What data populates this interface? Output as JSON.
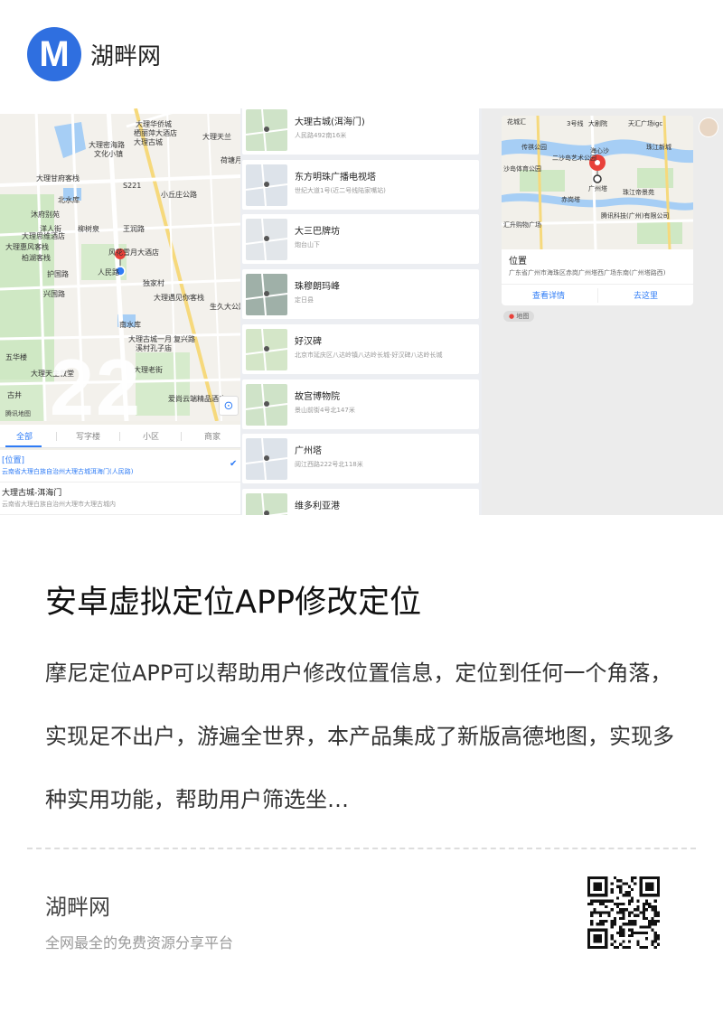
{
  "header": {
    "logo_letter": "M",
    "site_name": "湖畔网"
  },
  "panel_map": {
    "watermark": "22",
    "attribution": "腾讯地图",
    "locate_icon": "target-icon",
    "labels": [
      "大理华侨城",
      "栖丽萍大酒店",
      "大理古城",
      "大理密海路",
      "文化小镇",
      "大理甘府客栈",
      "北水库",
      "沐府别苑",
      "洋人街",
      "柳树泉",
      "大理思维酒店",
      "风花雪月大酒店",
      "大理惠风客栈",
      "柏湖客栈",
      "独家村",
      "大理遇见你客栈",
      "南水库",
      "大理古城一月",
      "溪村孔子庙",
      "大理老街",
      "五华楼",
      "古井",
      "大理天主教堂",
      "爱尚云端精品酒店",
      "荷塘月",
      "S221",
      "王润路",
      "大理天兰",
      "人民路",
      "护国路",
      "复兴路",
      "兴国路",
      "小丘庄公路",
      "生久大公路"
    ],
    "tabs": [
      "全部",
      "写字楼",
      "小区",
      "商家"
    ],
    "results": [
      {
        "title": "[位置]",
        "subtitle": "云南省大理白族自治州大理古城洱海门(人民路)",
        "selected": true
      },
      {
        "title": "大理古城-洱海门",
        "subtitle": "云南省大理白族自治州大理市大理古城内",
        "selected": false
      }
    ]
  },
  "panel_list": {
    "items": [
      {
        "title": "大理古城(洱海门)",
        "subtitle": "人民路492南16米"
      },
      {
        "title": "东方明珠广播电视塔",
        "subtitle": "世纪大道1号(近二号线陆家嘴站)"
      },
      {
        "title": "大三巴牌坊",
        "subtitle": "炮台山下"
      },
      {
        "title": "珠穆朗玛峰",
        "subtitle": "定日县"
      },
      {
        "title": "好汉碑",
        "subtitle": "北京市延庆区八达岭镇八达岭长城-好汉碑八达岭长城"
      },
      {
        "title": "故宫博物院",
        "subtitle": "景山前街4号北147米"
      },
      {
        "title": "广州塔",
        "subtitle": "阅江西路222号北118米"
      },
      {
        "title": "维多利亚港",
        "subtitle": ""
      }
    ]
  },
  "panel_detail": {
    "map_labels": [
      "天汇广场igc",
      "大剧院",
      "海心沙",
      "传祺公园",
      "二沙岛艺术公园",
      "沙岛体育公园",
      "广州塔",
      "赤岗塔",
      "珠江帝景苑",
      "腾讯科技(广州)有限公司",
      "汇升购物广场",
      "3号线",
      "花城汇",
      "珠江新城"
    ],
    "location_title": "位置",
    "location_address": "广东省广州市海珠区赤岗广州塔西广场东南(广州塔路西)",
    "button_details": "查看详情",
    "button_go": "去这里",
    "tag": "地图"
  },
  "article": {
    "title": "安卓虚拟定位APP修改定位",
    "description": "摩尼定位APP可以帮助用户修改位置信息，定位到任何一个角落，实现足不出户，游遍全世界，本产品集成了新版高德地图，实现多种实用功能，帮助用户筛选坐…"
  },
  "footer": {
    "site_name": "湖畔网",
    "tagline": "全网最全的免费资源分享平台"
  },
  "colors": {
    "brand": "#2f6fe0",
    "accent": "#2f7cf6",
    "pin_red": "#e8413a"
  }
}
